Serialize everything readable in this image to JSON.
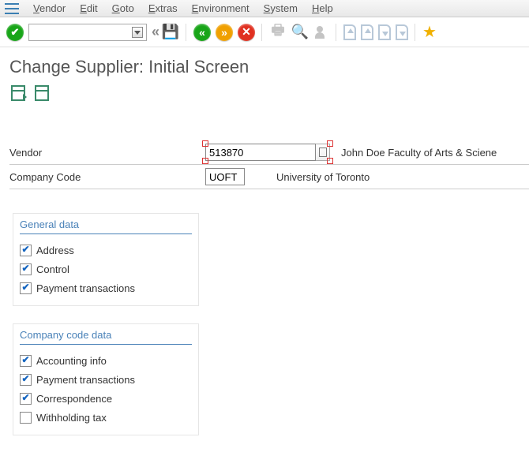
{
  "menu": {
    "items": [
      "Vendor",
      "Edit",
      "Goto",
      "Extras",
      "Environment",
      "System",
      "Help"
    ]
  },
  "page": {
    "title": "Change Supplier:  Initial Screen"
  },
  "form": {
    "vendor_label": "Vendor",
    "vendor_value": "513870",
    "vendor_desc": "John Doe Faculty of Arts & Sciene",
    "company_code_label": "Company Code",
    "company_code_value": "UOFT",
    "company_code_desc": "University of Toronto"
  },
  "groups": {
    "general": {
      "title": "General data",
      "items": [
        {
          "label": "Address",
          "checked": true
        },
        {
          "label": "Control",
          "checked": true
        },
        {
          "label": "Payment transactions",
          "checked": true
        }
      ]
    },
    "company": {
      "title": "Company code data",
      "items": [
        {
          "label": "Accounting info",
          "checked": true
        },
        {
          "label": "Payment transactions",
          "checked": true
        },
        {
          "label": "Correspondence",
          "checked": true
        },
        {
          "label": "Withholding tax",
          "checked": false
        }
      ]
    }
  }
}
